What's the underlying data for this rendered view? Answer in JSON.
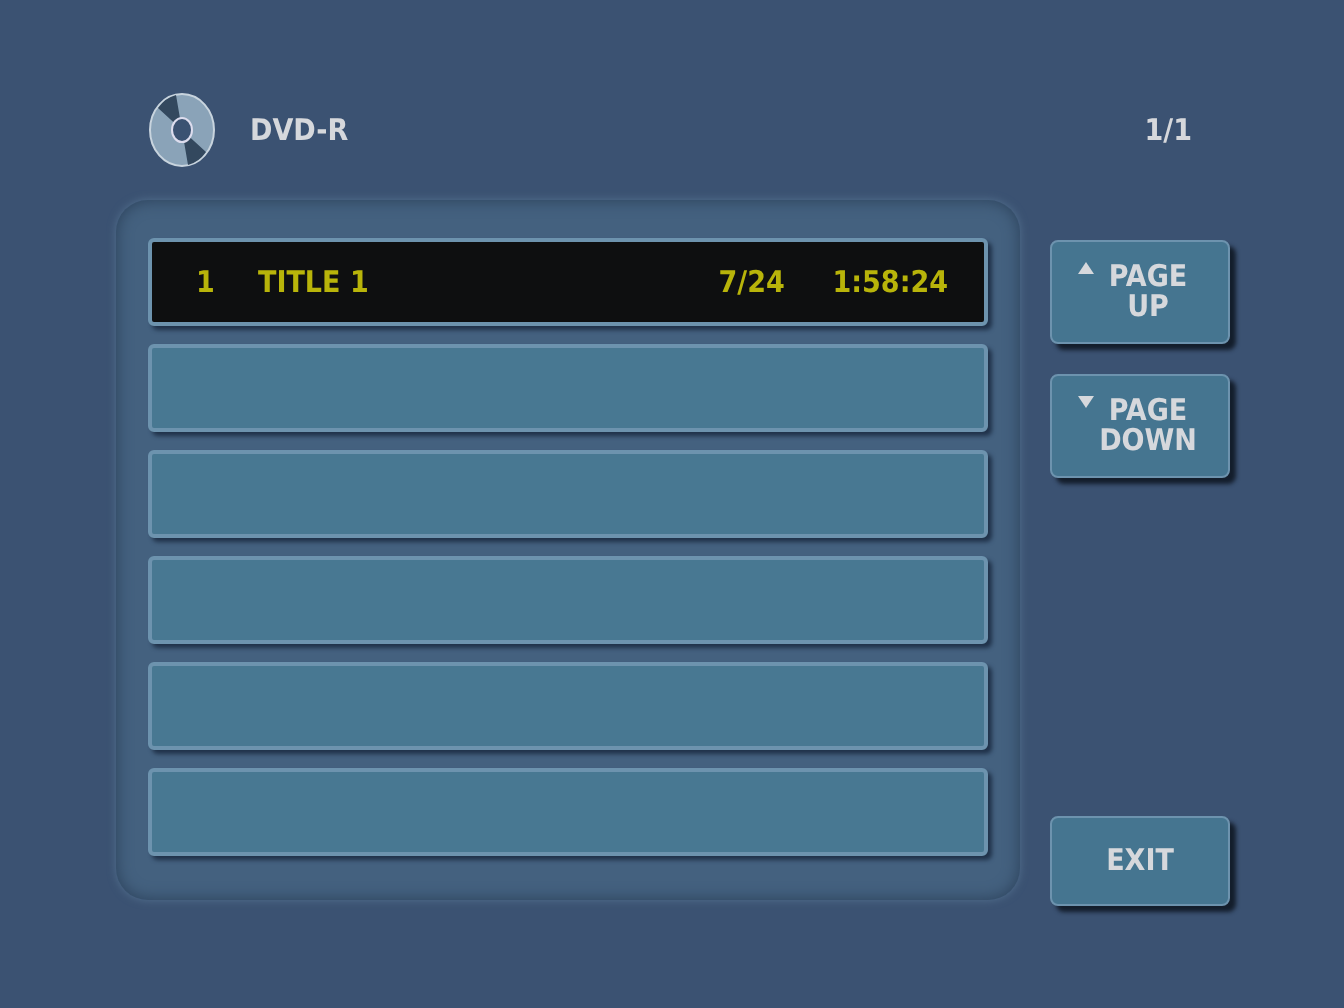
{
  "header": {
    "disc_label": "DVD-R",
    "page": "1/1"
  },
  "rows": [
    {
      "number": "1",
      "title": "TITLE 1",
      "chapter": "7/24",
      "time": "1:58:24",
      "selected": true
    },
    {
      "selected": false
    },
    {
      "selected": false
    },
    {
      "selected": false
    },
    {
      "selected": false
    },
    {
      "selected": false
    }
  ],
  "buttons": [
    {
      "kind": "up",
      "lines": [
        "PAGE",
        "UP"
      ]
    },
    {
      "kind": "down",
      "lines": [
        "PAGE",
        "DOWN"
      ]
    },
    {
      "kind": "plain",
      "lines": [
        "EXIT"
      ]
    }
  ]
}
